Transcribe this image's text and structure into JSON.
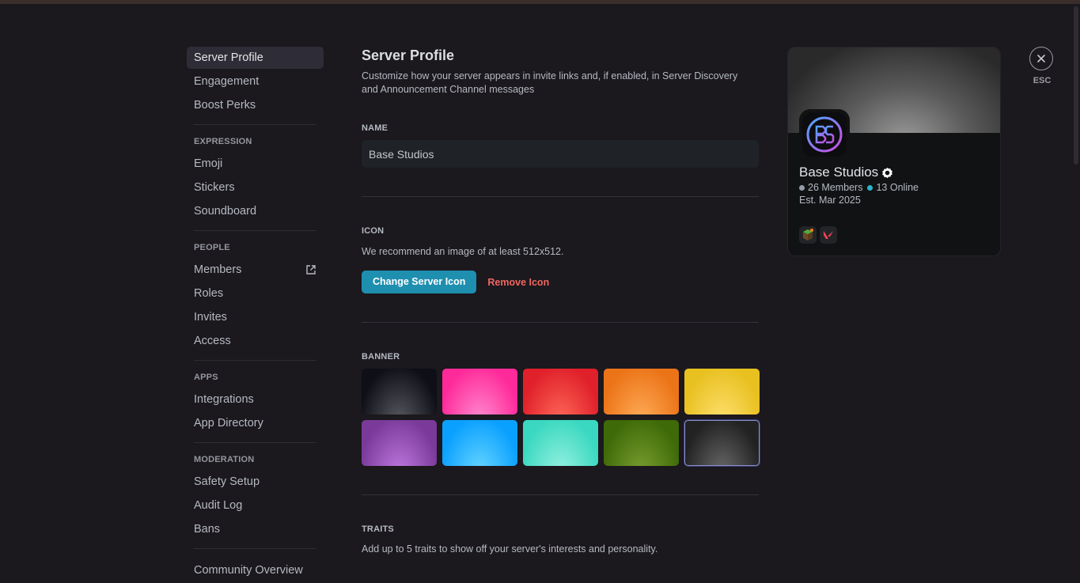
{
  "sidebar": {
    "items_top": [
      {
        "label": "Server Profile",
        "active": true
      },
      {
        "label": "Engagement"
      },
      {
        "label": "Boost Perks"
      }
    ],
    "sections": [
      {
        "header": "EXPRESSION",
        "items": [
          {
            "label": "Emoji"
          },
          {
            "label": "Stickers"
          },
          {
            "label": "Soundboard"
          }
        ]
      },
      {
        "header": "PEOPLE",
        "items": [
          {
            "label": "Members"
          },
          {
            "label": "Roles"
          },
          {
            "label": "Invites"
          },
          {
            "label": "Access"
          }
        ]
      },
      {
        "header": "APPS",
        "items": [
          {
            "label": "Integrations"
          },
          {
            "label": "App Directory"
          }
        ]
      },
      {
        "header": "MODERATION",
        "items": [
          {
            "label": "Safety Setup"
          },
          {
            "label": "Audit Log"
          },
          {
            "label": "Bans"
          }
        ]
      }
    ],
    "bottom_item": "Community Overview"
  },
  "main": {
    "title": "Server Profile",
    "description": "Customize how your server appears in invite links and, if enabled, in Server Discovery and Announcement Channel messages",
    "name_section": {
      "label": "NAME",
      "value": "Base Studios"
    },
    "icon_section": {
      "label": "ICON",
      "help": "We recommend an image of at least 512x512.",
      "change_button": "Change Server Icon",
      "remove_button": "Remove Icon"
    },
    "banner_section": {
      "label": "BANNER",
      "colors": [
        {
          "name": "black",
          "from": "#0f0f17",
          "to": "#5a5a62"
        },
        {
          "name": "pink",
          "from": "#ff2a9a",
          "to": "#ff8fd0"
        },
        {
          "name": "red",
          "from": "#e0202a",
          "to": "#ff6a5a"
        },
        {
          "name": "orange",
          "from": "#ec7418",
          "to": "#ffae5a"
        },
        {
          "name": "yellow",
          "from": "#e8c020",
          "to": "#ffe070"
        },
        {
          "name": "purple",
          "from": "#7a3a9a",
          "to": "#c27ae0"
        },
        {
          "name": "blue",
          "from": "#0aa0ff",
          "to": "#6ad8ff"
        },
        {
          "name": "mint",
          "from": "#3ad8c0",
          "to": "#9af2e2"
        },
        {
          "name": "green",
          "from": "#3e6a08",
          "to": "#7aa030"
        },
        {
          "name": "gray",
          "from": "#222222",
          "to": "#6a6a6a",
          "selected": true
        }
      ]
    },
    "traits_section": {
      "label": "TRAITS",
      "help": "Add up to 5 traits to show off your server's interests and personality."
    }
  },
  "preview": {
    "server_name": "Base Studios",
    "members": "26 Members",
    "online": "13 Online",
    "established": "Est. Mar 2025",
    "members_dot_color": "#949ba4",
    "online_dot_color": "#2ab5c8"
  },
  "close": {
    "label": "ESC"
  }
}
